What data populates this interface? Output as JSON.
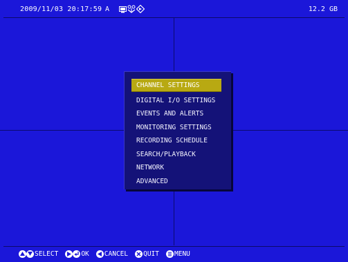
{
  "status_bar": {
    "datetime": "2009/11/03 20:17:59",
    "mode": "A",
    "storage": "12.2 GB",
    "icons": [
      "monitor-icon",
      "network-icon",
      "record-icon"
    ]
  },
  "menu": {
    "selected_index": 0,
    "items": [
      {
        "label": "CHANNEL SETTINGS"
      },
      {
        "label": "DIGITAL I/O SETTINGS"
      },
      {
        "label": "EVENTS AND ALERTS"
      },
      {
        "label": "MONITORING SETTINGS"
      },
      {
        "label": "RECORDING SCHEDULE"
      },
      {
        "label": "SEARCH/PLAYBACK"
      },
      {
        "label": "NETWORK"
      },
      {
        "label": "ADVANCED"
      }
    ]
  },
  "hints": {
    "select": "SELECT",
    "ok": "OK",
    "cancel": "CANCEL",
    "quit": "QUIT",
    "menu": "MENU"
  },
  "colors": {
    "background": "#1b17d9",
    "menu_bg": "#141278",
    "highlight": "#b8a912"
  }
}
